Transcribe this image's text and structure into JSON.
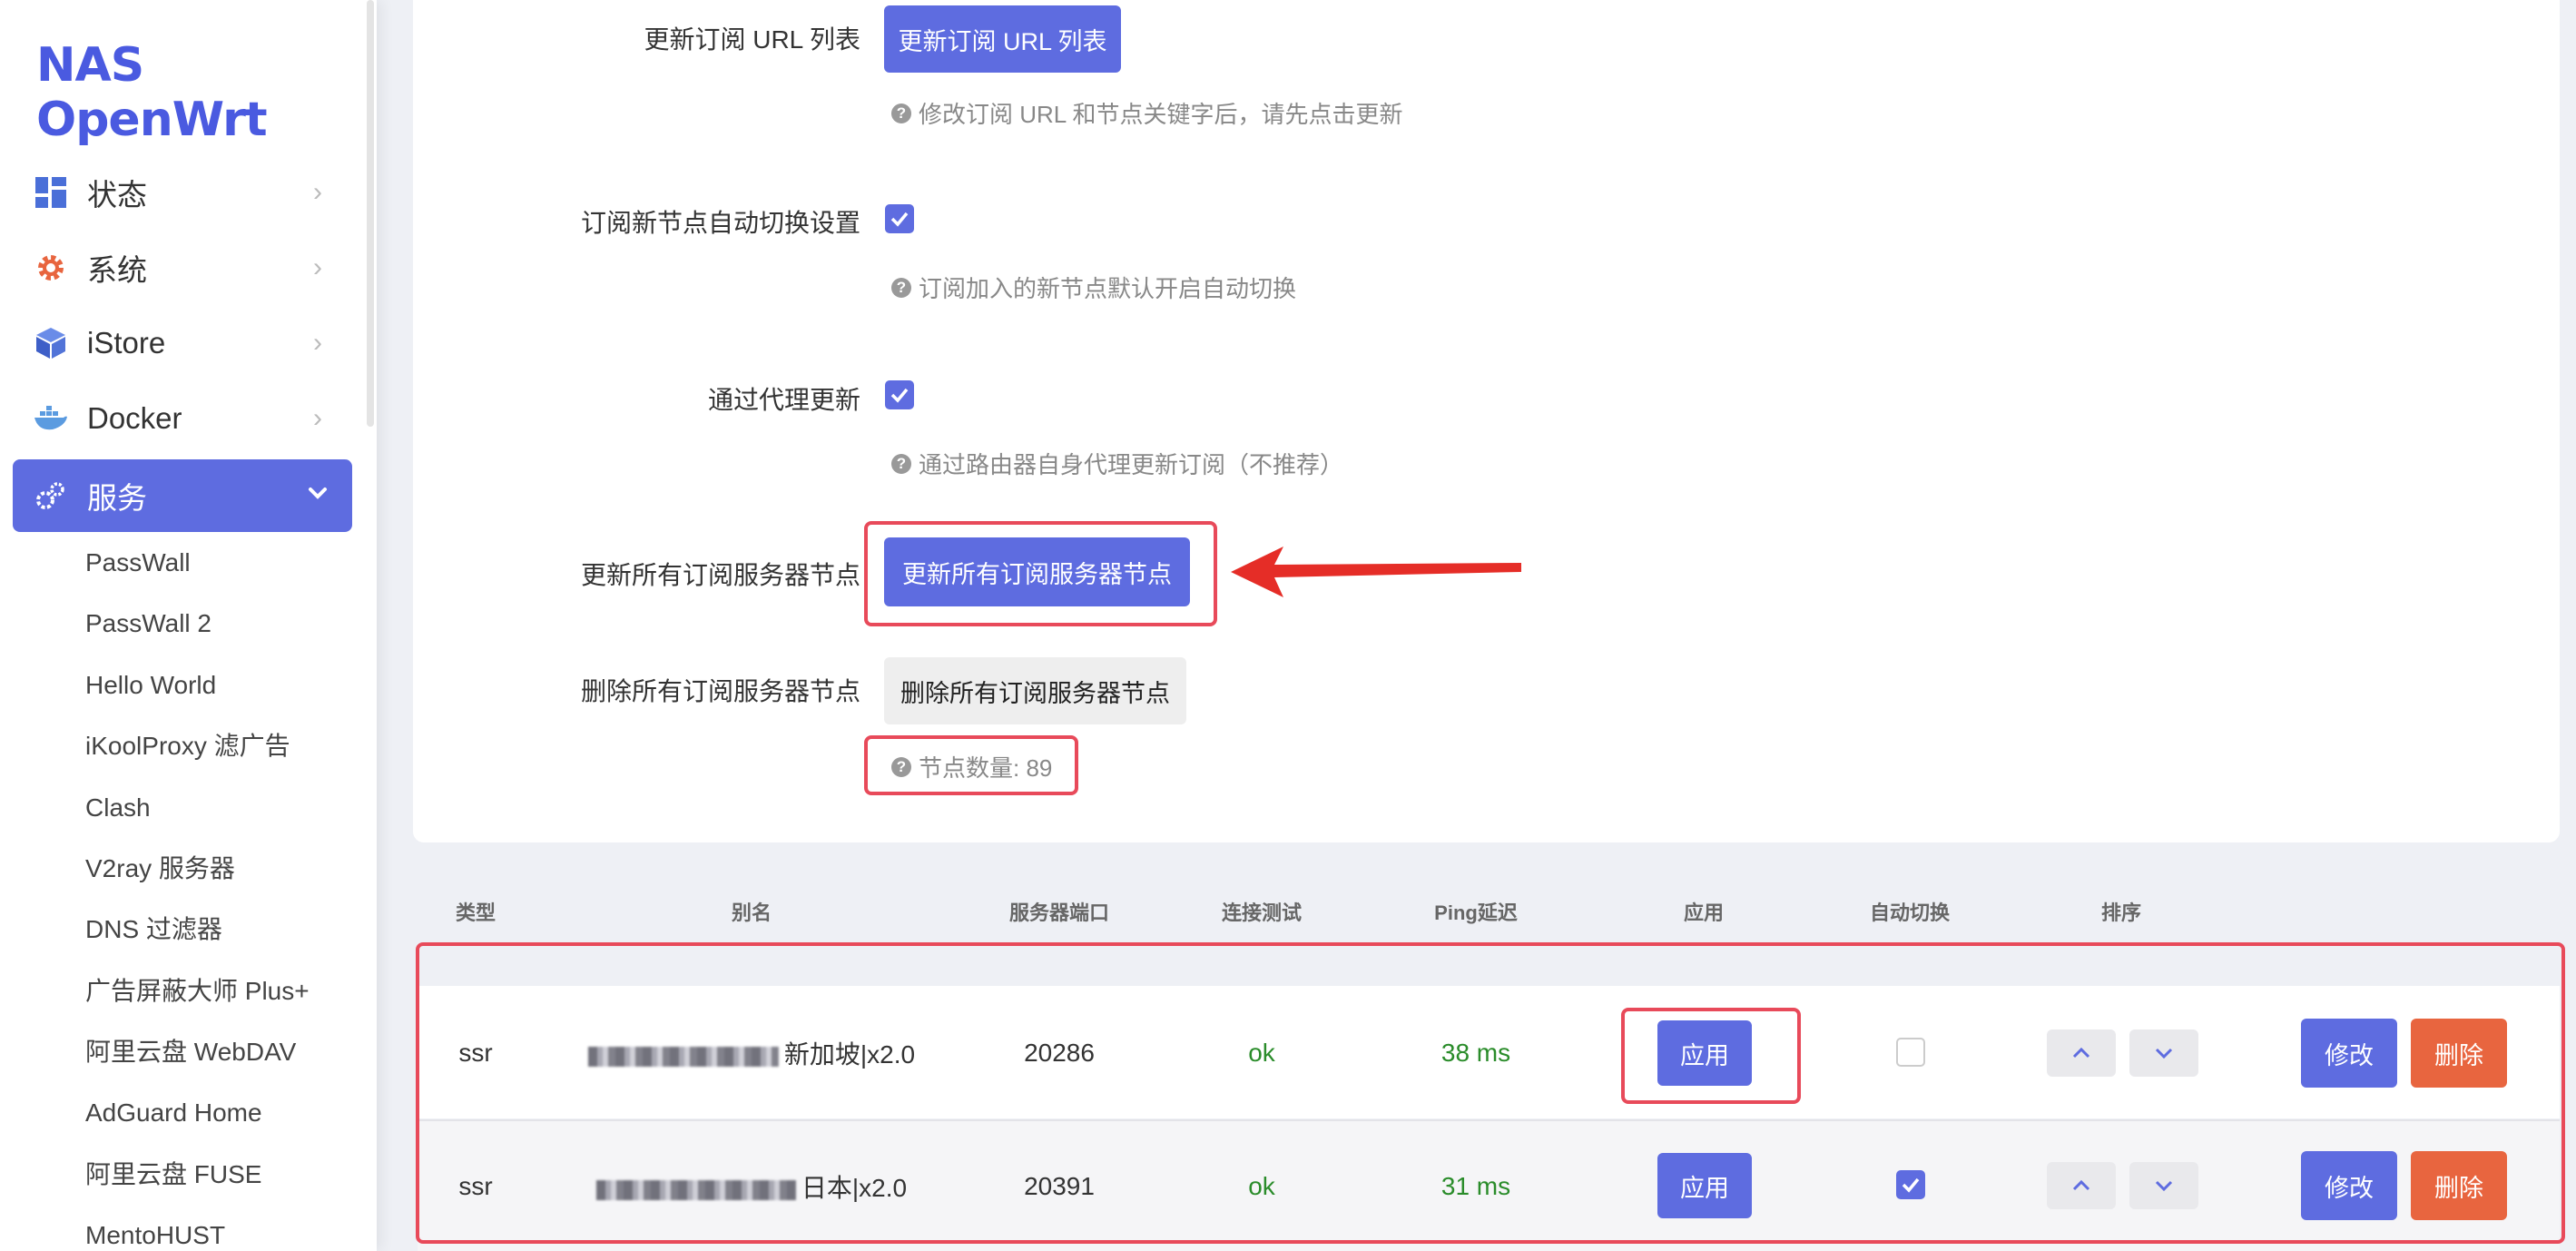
{
  "brand": {
    "name": "NAS OpenWrt",
    "color": "#4a5ae0"
  },
  "sidebar": {
    "menu": [
      {
        "label": "状态",
        "icon": "dashboard-icon"
      },
      {
        "label": "系统",
        "icon": "gear-icon"
      },
      {
        "label": "iStore",
        "icon": "cube-icon"
      },
      {
        "label": "Docker",
        "icon": "docker-whale-icon"
      },
      {
        "label": "服务",
        "icon": "services-gears-icon",
        "active": true
      }
    ],
    "submenu": [
      "PassWall",
      "PassWall 2",
      "Hello World",
      "iKoolProxy 滤广告",
      "Clash",
      "V2ray 服务器",
      "DNS 过滤器",
      "广告屏蔽大师 Plus+",
      "阿里云盘 WebDAV",
      "AdGuard Home",
      "阿里云盘 FUSE",
      "MentoHUST"
    ]
  },
  "settings": {
    "update_url_list": {
      "label": "更新订阅 URL 列表",
      "button": "更新订阅 URL 列表",
      "hint": "修改订阅 URL 和节点关键字后，请先点击更新"
    },
    "auto_switch_new": {
      "label": "订阅新节点自动切换设置",
      "checked": true,
      "hint": "订阅加入的新节点默认开启自动切换"
    },
    "proxy_update": {
      "label": "通过代理更新",
      "checked": true,
      "hint": "通过路由器自身代理更新订阅（不推荐）"
    },
    "update_all": {
      "label": "更新所有订阅服务器节点",
      "button": "更新所有订阅服务器节点"
    },
    "delete_all": {
      "label": "删除所有订阅服务器节点",
      "button": "删除所有订阅服务器节点"
    },
    "node_count": "节点数量: 89"
  },
  "table": {
    "headers": [
      "类型",
      "别名",
      "服务器端口",
      "连接测试",
      "Ping延迟",
      "应用",
      "自动切换",
      "排序"
    ],
    "rows": [
      {
        "type": "ssr",
        "alias": "新加坡|x2.0",
        "port": "20286",
        "test": "ok",
        "ping": "38 ms",
        "apply": "应用",
        "auto_switch": false,
        "edit": "修改",
        "delete": "删除"
      },
      {
        "type": "ssr",
        "alias": "日本|x2.0",
        "port": "20391",
        "test": "ok",
        "ping": "31 ms",
        "apply": "应用",
        "auto_switch": true,
        "edit": "修改",
        "delete": "删除"
      }
    ]
  },
  "colors": {
    "primary": "#5e6ce0",
    "danger": "#e8653f",
    "highlight": "#e84a5a",
    "arrow": "#e52d27",
    "ok": "#2a8c2a"
  }
}
